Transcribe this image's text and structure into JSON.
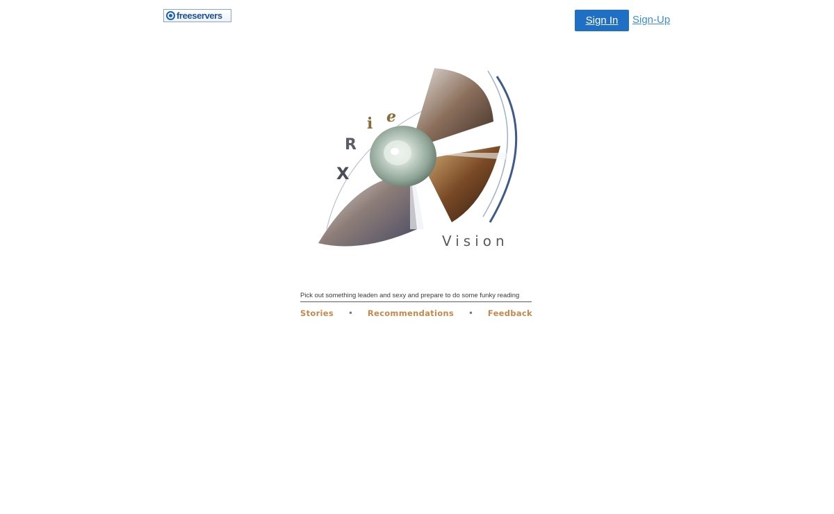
{
  "header": {
    "logo_text": "freeservers",
    "signin_label": "Sign In",
    "signup_label": "Sign-Up"
  },
  "hero": {
    "title_letters": [
      "X",
      "R",
      "i",
      "e"
    ],
    "subtitle": "Vision"
  },
  "tagline": "Pick out something leaden and sexy and prepare to do some funky reading",
  "nav": {
    "items": [
      "Stories",
      "Recommendations",
      "Feedback"
    ],
    "separator": "•"
  },
  "colors": {
    "signin_bg": "#1f6fc5",
    "signup_link": "#3a8fd6",
    "nav_link": "#c9874a"
  }
}
